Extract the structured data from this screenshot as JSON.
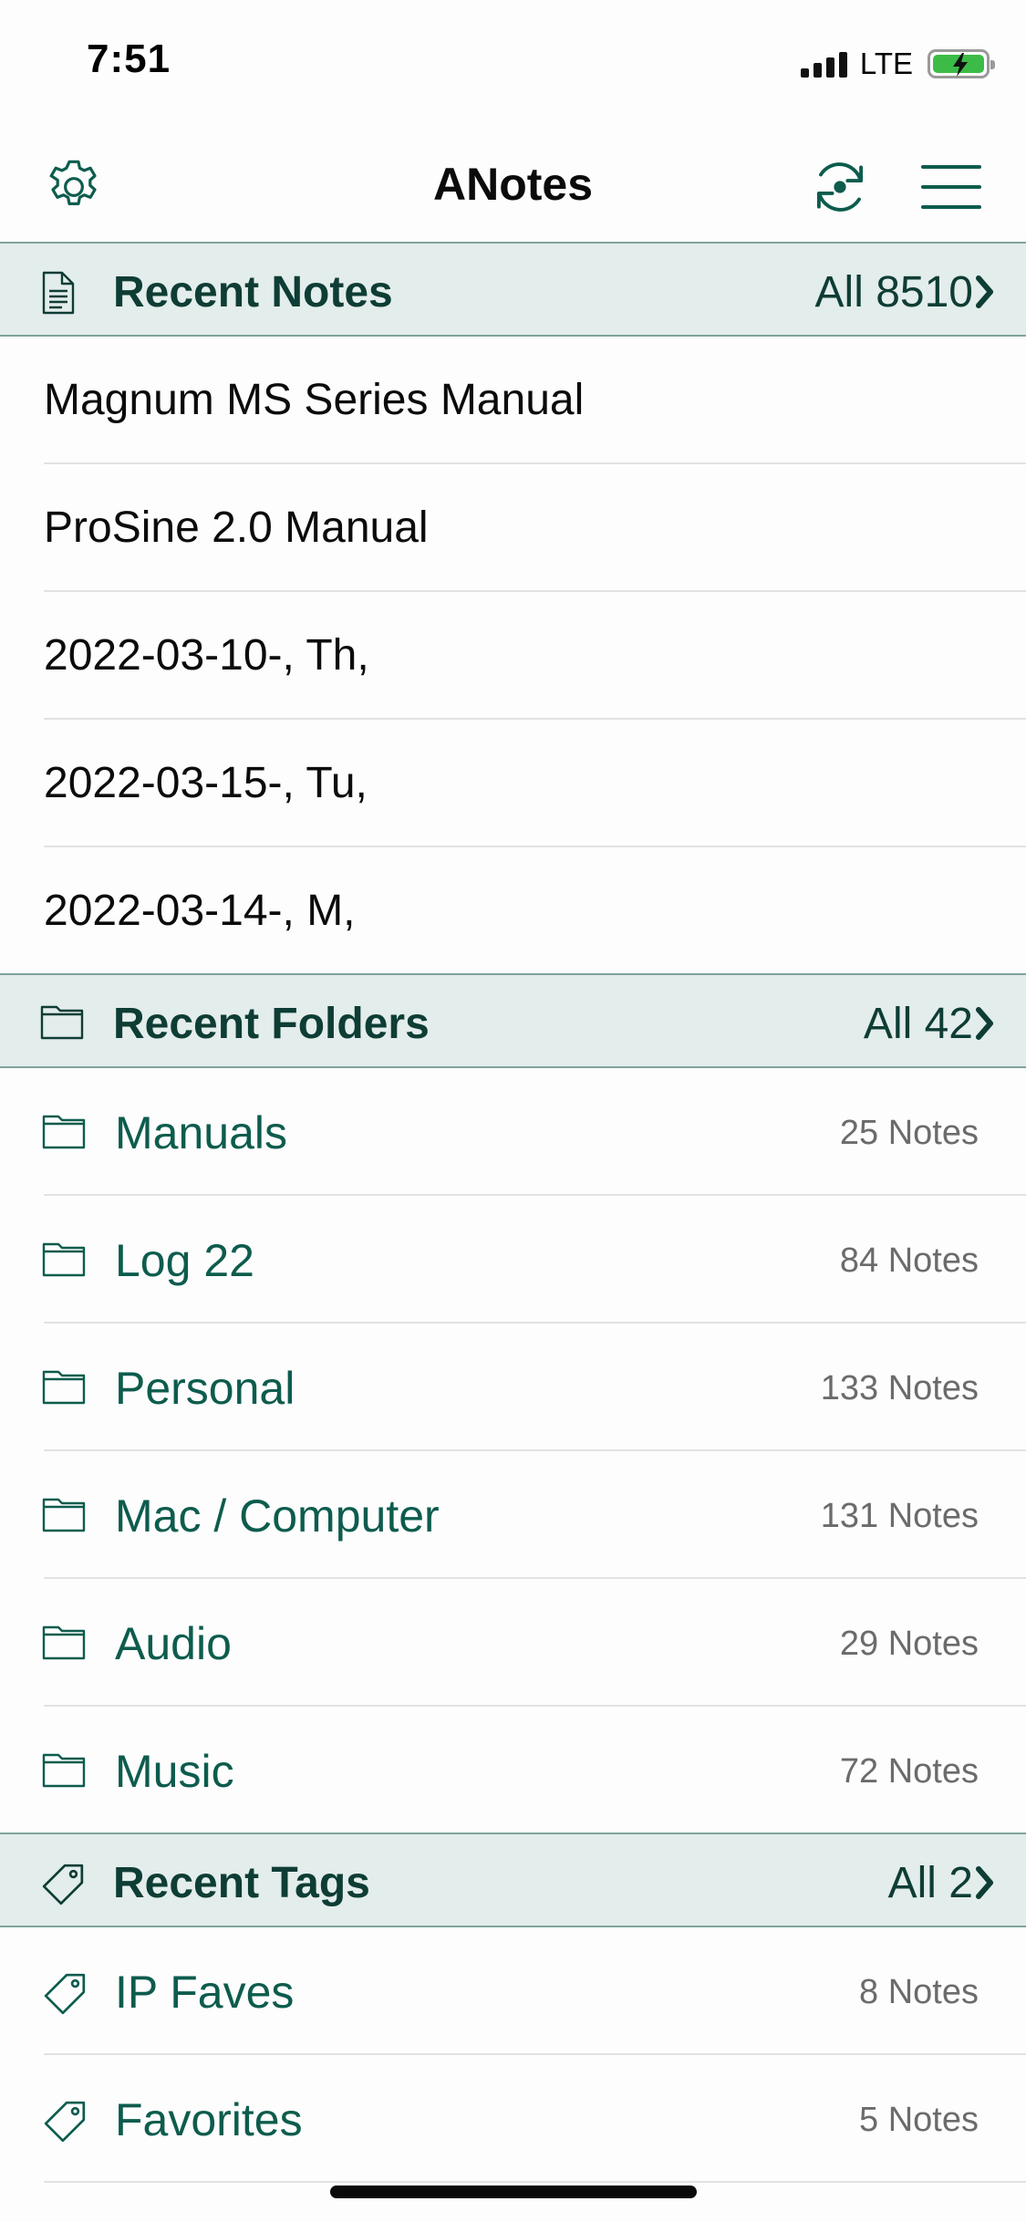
{
  "status_bar": {
    "time": "7:51",
    "network": "LTE"
  },
  "nav": {
    "title": "ANotes"
  },
  "colors": {
    "accent": "#0d5c4d",
    "header_bg": "#e3edeb",
    "header_text": "#0e3d35"
  },
  "recent_notes": {
    "title": "Recent Notes",
    "all_label": "All 8510",
    "items": [
      {
        "title": "Magnum MS Series Manual"
      },
      {
        "title": "ProSine 2.0 Manual"
      },
      {
        "title": "2022-03-10-, Th,"
      },
      {
        "title": "2022-03-15-, Tu,"
      },
      {
        "title": "2022-03-14-, M,"
      }
    ]
  },
  "recent_folders": {
    "title": "Recent Folders",
    "all_label": "All 42",
    "items": [
      {
        "name": "Manuals",
        "count": "25 Notes"
      },
      {
        "name": "Log 22",
        "count": "84 Notes"
      },
      {
        "name": "Personal",
        "count": "133 Notes"
      },
      {
        "name": "Mac / Computer",
        "count": "131 Notes"
      },
      {
        "name": "Audio",
        "count": "29 Notes"
      },
      {
        "name": "Music",
        "count": "72 Notes"
      }
    ]
  },
  "recent_tags": {
    "title": "Recent Tags",
    "all_label": "All 2",
    "items": [
      {
        "name": "IP Faves",
        "count": "8 Notes"
      },
      {
        "name": "Favorites",
        "count": "5 Notes"
      }
    ]
  },
  "icons": {
    "settings": "gear-icon",
    "sync": "sync-icon",
    "menu": "hamburger-menu-icon",
    "note": "document-icon",
    "folder": "folder-icon",
    "tag": "tag-icon",
    "chevron": "chevron-right-icon"
  }
}
